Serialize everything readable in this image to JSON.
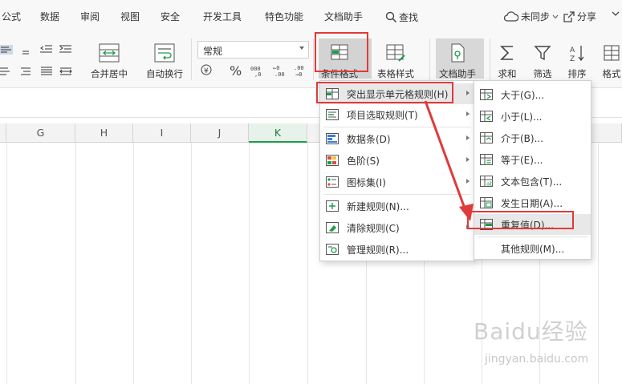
{
  "menu_tabs": [
    "公式",
    "数据",
    "审阅",
    "视图",
    "安全",
    "开发工具",
    "特色功能",
    "文档助手"
  ],
  "search_label": "查找",
  "top_right": {
    "sync": "未同步",
    "share": "分享"
  },
  "ribbon": {
    "merge_label": "合并居中",
    "wrap_label": "自动换行",
    "number_format": "常规",
    "currency_symbol": "¥",
    "percent_symbol": "%",
    "conditional_format_label": "条件格式",
    "table_style_label": "表格样式",
    "doc_helper_label": "文档助手",
    "sum_label": "求和",
    "filter_label": "筛选",
    "sort_label": "排序",
    "format_label": "格式"
  },
  "columns": [
    "G",
    "H",
    "I",
    "J",
    "K"
  ],
  "active_column": "K",
  "menu": {
    "items": [
      {
        "label": "突出显示单元格规则(H)",
        "icon": "highlight-rules-icon",
        "has_sub": true
      },
      {
        "label": "项目选取规则(T)",
        "icon": "top-bottom-rules-icon",
        "has_sub": true
      },
      {
        "label": "数据条(D)",
        "icon": "data-bars-icon",
        "has_sub": true
      },
      {
        "label": "色阶(S)",
        "icon": "color-scale-icon",
        "has_sub": true
      },
      {
        "label": "图标集(I)",
        "icon": "icon-sets-icon",
        "has_sub": true
      },
      {
        "label": "新建规则(N)...",
        "icon": "new-rule-icon",
        "has_sub": false
      },
      {
        "label": "清除规则(C)",
        "icon": "clear-rules-icon",
        "has_sub": true
      },
      {
        "label": "管理规则(R)...",
        "icon": "manage-rules-icon",
        "has_sub": false
      }
    ]
  },
  "submenu": {
    "items": [
      {
        "label": "大于(G)...",
        "icon": "greater-than-icon"
      },
      {
        "label": "小于(L)...",
        "icon": "less-than-icon"
      },
      {
        "label": "介于(B)...",
        "icon": "between-icon"
      },
      {
        "label": "等于(E)...",
        "icon": "equal-to-icon"
      },
      {
        "label": "文本包含(T)...",
        "icon": "text-contains-icon"
      },
      {
        "label": "发生日期(A)...",
        "icon": "date-occurring-icon"
      },
      {
        "label": "重复值(D)...",
        "icon": "duplicate-values-icon"
      },
      {
        "label": "其他规则(M)...",
        "icon": ""
      }
    ]
  },
  "colors": {
    "accent_green": "#1f9d4a",
    "highlight_red": "#e03a3a"
  },
  "watermark": {
    "main": "Baidu经验",
    "sub": "jingyan.baidu.com"
  }
}
